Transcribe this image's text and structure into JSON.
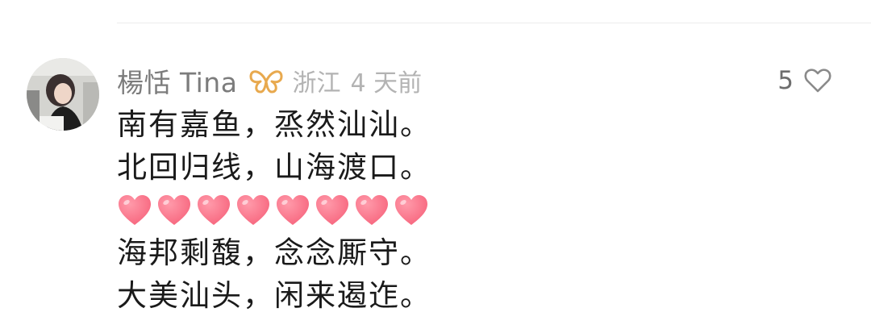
{
  "comment": {
    "username": "楊恬 Tina",
    "badge_icon": "butterfly-badge-icon",
    "location": "浙江",
    "time": "4 天前",
    "like_count": "5",
    "like_icon": "heart-outline-icon",
    "lines": [
      "南有嘉鱼，烝然汕汕。",
      "北回归线，山海渡口。",
      "海邦剩馥，念念厮守。",
      "大美汕头，闲来遏迮。"
    ],
    "emoji_row": {
      "icon": "pink-heart-emoji",
      "count": 8
    }
  },
  "colors": {
    "username": "#7c7c7c",
    "meta": "#b3b3b3",
    "badge": "#e8a94e",
    "heart_emoji": "#f7667e",
    "text": "#1a1a1a"
  }
}
